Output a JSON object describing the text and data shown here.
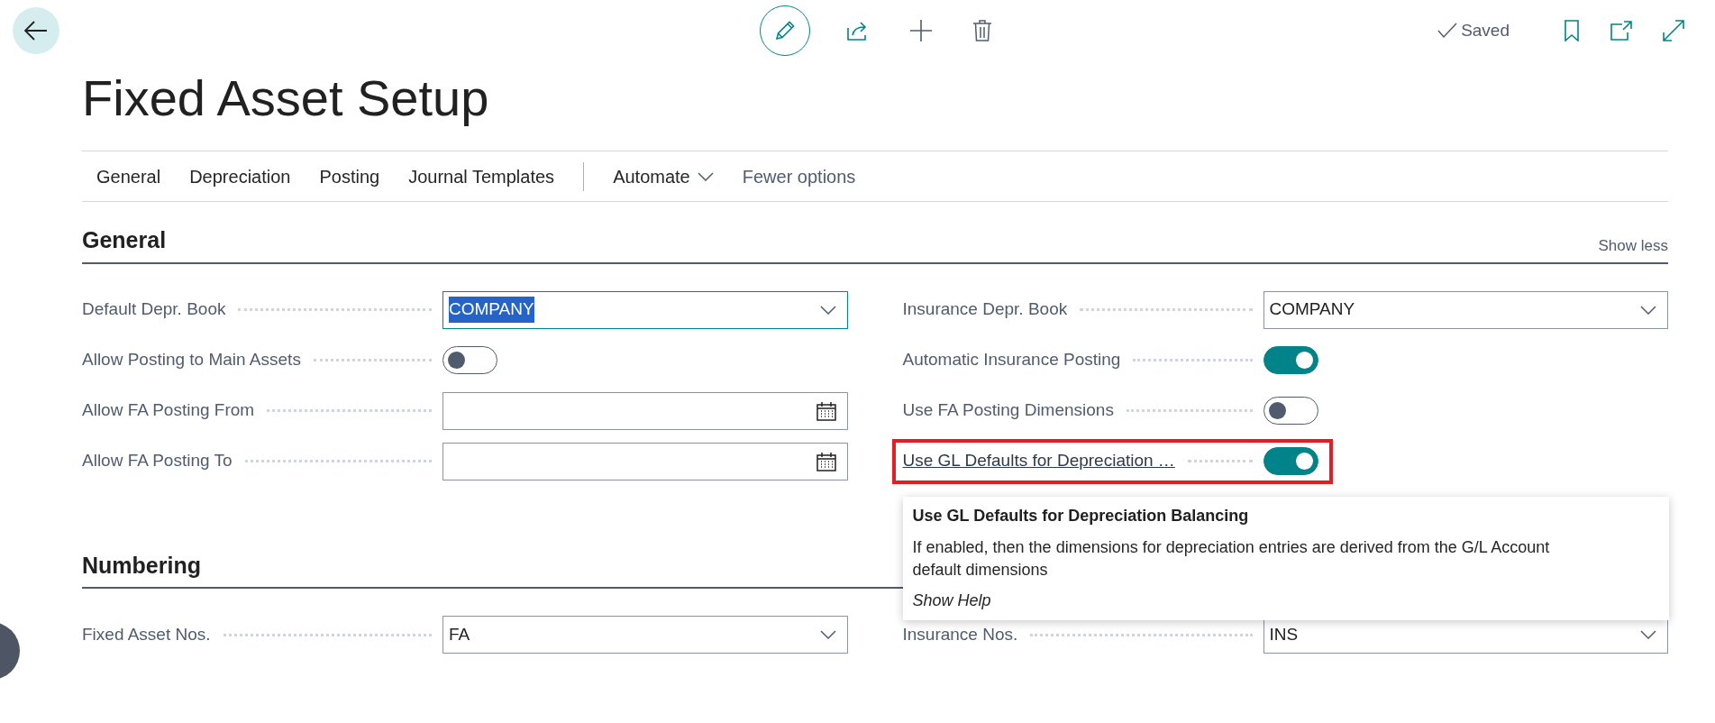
{
  "app_bar": {
    "status": "Saved"
  },
  "page": {
    "title": "Fixed Asset Setup"
  },
  "action_tabs": [
    {
      "label": "General",
      "kind": "link"
    },
    {
      "label": "Depreciation",
      "kind": "link"
    },
    {
      "label": "Posting",
      "kind": "link"
    },
    {
      "label": "Journal Templates",
      "kind": "link"
    },
    {
      "label": "Automate",
      "kind": "menu"
    },
    {
      "label": "Fewer options",
      "kind": "more"
    }
  ],
  "sections": [
    {
      "title": "General",
      "show_less": "Show less",
      "left_fields": [
        {
          "label": "Default Depr. Book",
          "kind": "select",
          "value": "COMPANY",
          "focused": true
        },
        {
          "label": "Allow Posting to Main Assets",
          "kind": "toggle",
          "on": false
        },
        {
          "label": "Allow FA Posting From",
          "kind": "date"
        },
        {
          "label": "Allow FA Posting To",
          "kind": "date"
        }
      ],
      "right_fields": [
        {
          "label": "Insurance Depr. Book",
          "kind": "select",
          "value": "COMPANY",
          "focused": false
        },
        {
          "label": "Automatic Insurance Posting",
          "kind": "toggle",
          "on": true
        },
        {
          "label": "Use FA Posting Dimensions",
          "kind": "toggle",
          "on": false
        },
        {
          "label": "Use GL Defaults for Depreciation …",
          "kind": "toggle",
          "on": true,
          "highlighted": true,
          "tooltip": {
            "title": "Use GL Defaults for Depreciation Balancing",
            "text": "If enabled, then the dimensions for depreciation entries are derived from the G/L Account default dimensions",
            "link": "Show Help"
          }
        }
      ]
    },
    {
      "title": "Numbering",
      "left_fields": [
        {
          "label": "Fixed Asset Nos.",
          "kind": "select",
          "value": "FA",
          "focused": false
        }
      ],
      "right_fields": [
        {
          "label": "Insurance Nos.",
          "kind": "select",
          "value": "INS",
          "focused": false
        }
      ]
    }
  ]
}
